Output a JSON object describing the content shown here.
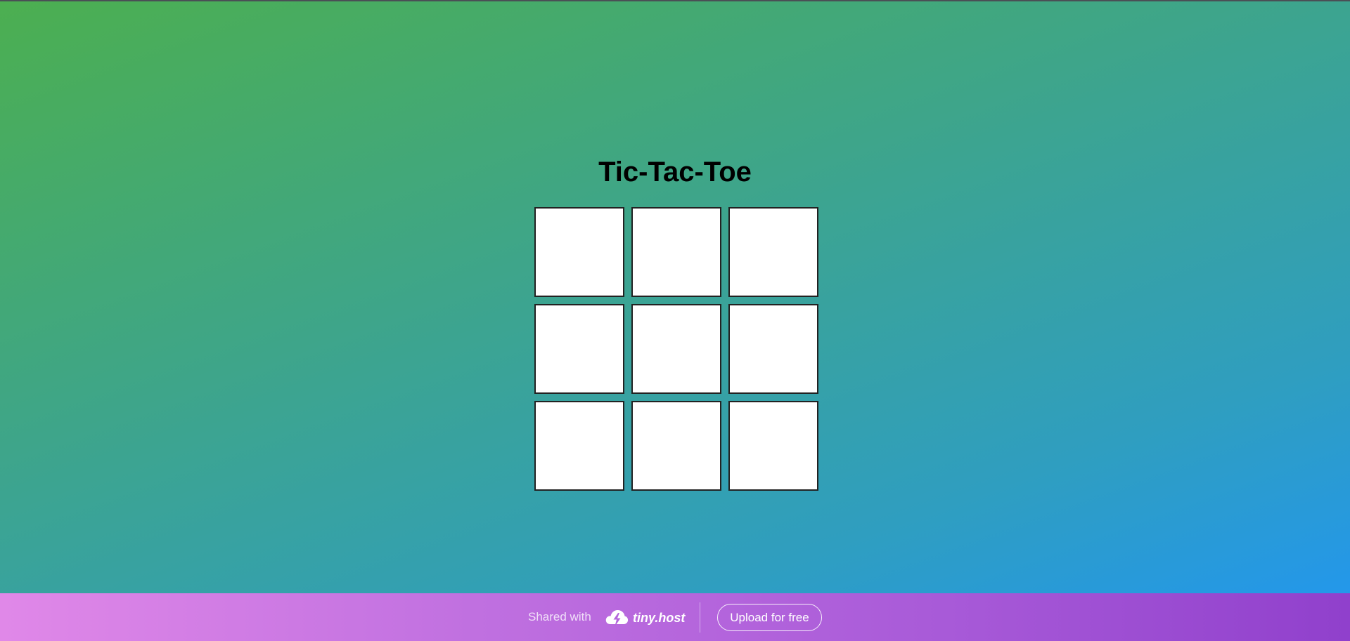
{
  "game": {
    "title": "Tic-Tac-Toe",
    "board": {
      "cells": [
        "",
        "",
        "",
        "",
        "",
        "",
        "",
        "",
        ""
      ]
    }
  },
  "footer": {
    "shared_label": "Shared with",
    "logo_icon": "cloud-lightning-icon",
    "brand": "tiny.host",
    "upload_label": "Upload for free"
  },
  "colors": {
    "background_start": "#4caf50",
    "background_end": "#2196f3",
    "footer_start": "#e088e8",
    "footer_end": "#9040cc",
    "cell_background": "#ffffff",
    "cell_border": "#222222"
  }
}
